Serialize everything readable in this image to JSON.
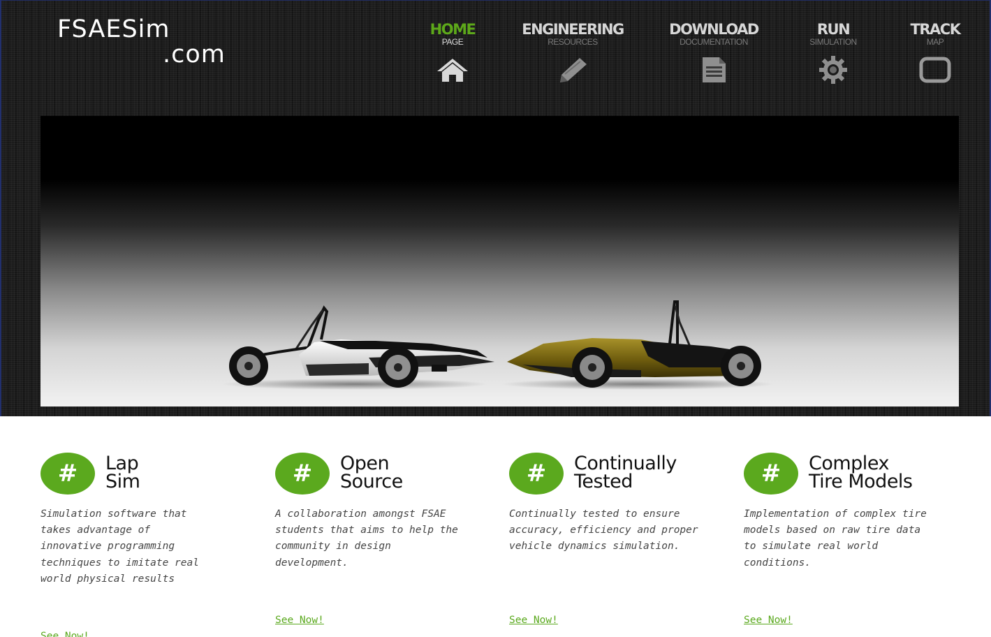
{
  "logo": {
    "line1": "FSAESim",
    "line2": ".com"
  },
  "nav": [
    {
      "title": "HOME",
      "subtitle": "PAGE",
      "icon": "home-icon",
      "active": true
    },
    {
      "title": "ENGINEERING",
      "subtitle": "RESOURCES",
      "icon": "pencil-icon",
      "active": false
    },
    {
      "title": "DOWNLOAD",
      "subtitle": "DOCUMENTATION",
      "icon": "document-icon",
      "active": false
    },
    {
      "title": "RUN",
      "subtitle": "SIMULATION",
      "icon": "gear-icon",
      "active": false
    },
    {
      "title": "TRACK",
      "subtitle": "MAP",
      "icon": "track-icon",
      "active": false
    }
  ],
  "hero": {
    "image": "two-formula-sae-cars"
  },
  "features": [
    {
      "badge": "#",
      "title_line1": "Lap",
      "title_line2": "Sim",
      "description": "Simulation software that takes advantage of innovative programming techniques to imitate real world physical results",
      "link": "See Now!"
    },
    {
      "badge": "#",
      "title_line1": "Open",
      "title_line2": "Source",
      "description": "A collaboration amongst FSAE students that aims to help the community in design development.",
      "link": "See Now!"
    },
    {
      "badge": "#",
      "title_line1": "Continually",
      "title_line2": "Tested",
      "description": "Continually tested to ensure accuracy, efficiency and proper vehicle dynamics simulation.",
      "link": "See Now!"
    },
    {
      "badge": "#",
      "title_line1": "Complex",
      "title_line2": "Tire Models",
      "description": "Implementation of complex tire models based on raw tire data to simulate real world conditions.",
      "link": "See Now!"
    }
  ],
  "colors": {
    "accent": "#5ba91e",
    "nav_active": "#5da81a",
    "background": "#1b1b1b"
  }
}
